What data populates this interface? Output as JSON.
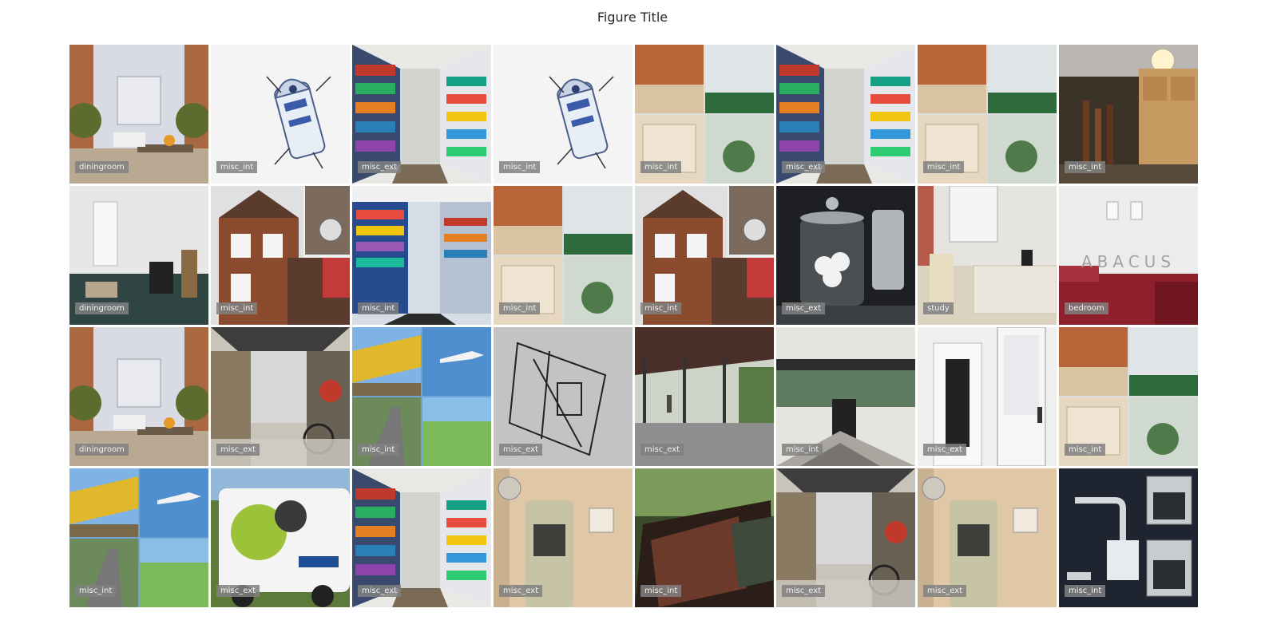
{
  "title": "Figure Title",
  "tiles": [
    {
      "label": "diningroom",
      "scene": "dining"
    },
    {
      "label": "misc_int",
      "scene": "robot"
    },
    {
      "label": "misc_ext",
      "scene": "store"
    },
    {
      "label": "misc_int",
      "scene": "robot"
    },
    {
      "label": "misc_int",
      "scene": "collage"
    },
    {
      "label": "misc_ext",
      "scene": "store"
    },
    {
      "label": "misc_int",
      "scene": "collage"
    },
    {
      "label": "misc_int",
      "scene": "warehouse"
    },
    {
      "label": "diningroom",
      "scene": "emptyroom"
    },
    {
      "label": "misc_int",
      "scene": "house"
    },
    {
      "label": "misc_int",
      "scene": "store2"
    },
    {
      "label": "misc_int",
      "scene": "collage"
    },
    {
      "label": "misc_int",
      "scene": "house"
    },
    {
      "label": "misc_ext",
      "scene": "jar"
    },
    {
      "label": "study",
      "scene": "study"
    },
    {
      "label": "bedroom",
      "scene": "bedroom",
      "watermark": "ABACUS"
    },
    {
      "label": "diningroom",
      "scene": "dining"
    },
    {
      "label": "misc_ext",
      "scene": "garage"
    },
    {
      "label": "misc_int",
      "scene": "transport"
    },
    {
      "label": "misc_ext",
      "scene": "blueprint"
    },
    {
      "label": "misc_ext",
      "scene": "shelter"
    },
    {
      "label": "misc_int",
      "scene": "livingroom"
    },
    {
      "label": "misc_ext",
      "scene": "door"
    },
    {
      "label": "misc_int",
      "scene": "collage"
    },
    {
      "label": "misc_int",
      "scene": "transport"
    },
    {
      "label": "misc_ext",
      "scene": "van"
    },
    {
      "label": "misc_ext",
      "scene": "store"
    },
    {
      "label": "misc_ext",
      "scene": "intercom"
    },
    {
      "label": "misc_int",
      "scene": "sign"
    },
    {
      "label": "misc_ext",
      "scene": "garage"
    },
    {
      "label": "misc_ext",
      "scene": "intercom"
    },
    {
      "label": "misc_int",
      "scene": "fixtures"
    }
  ]
}
